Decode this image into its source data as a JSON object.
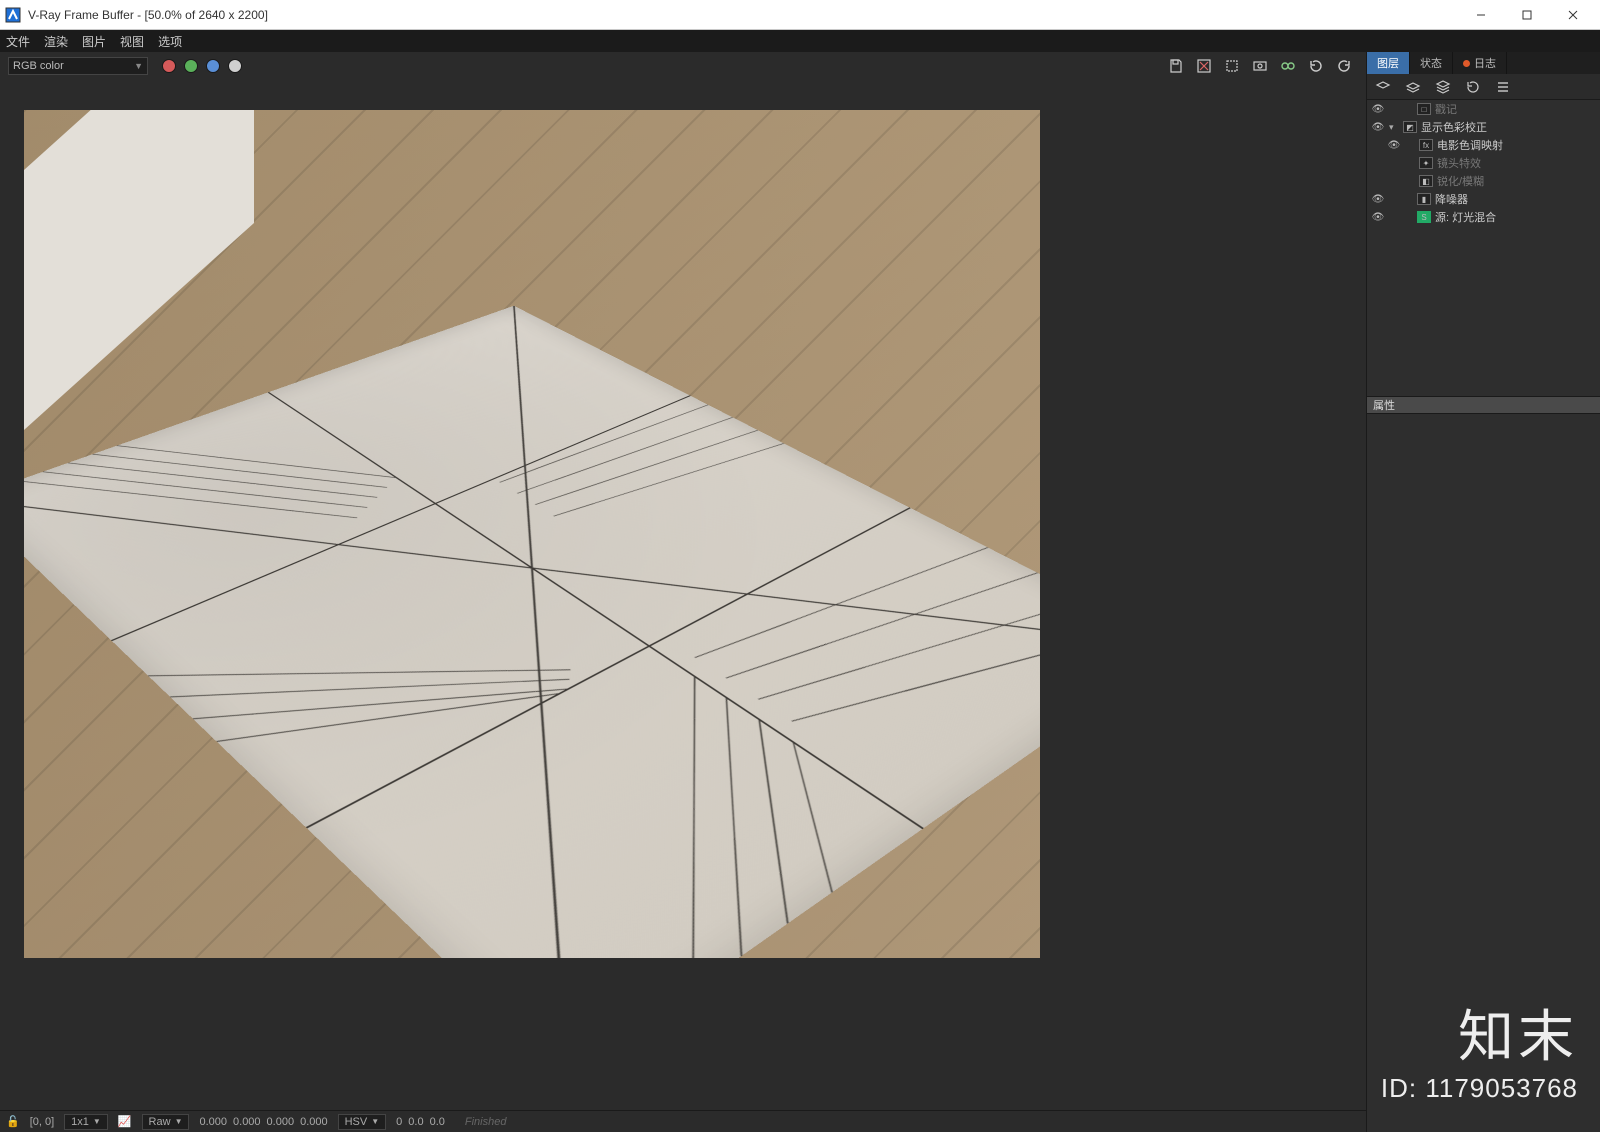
{
  "window": {
    "title": "V-Ray Frame Buffer - [50.0% of 2640 x 2200]"
  },
  "menu": {
    "items": [
      "文件",
      "渲染",
      "图片",
      "视图",
      "选项"
    ]
  },
  "toolbar": {
    "channel_dropdown": "RGB color"
  },
  "viewport": {
    "status_label": "Finished"
  },
  "statusbar": {
    "lock_icon": "🔓",
    "coords": "[0, 0]",
    "zoom": "1x1",
    "raw_label": "Raw",
    "raw_values": [
      "0.000",
      "0.000",
      "0.000",
      "0.000"
    ],
    "hsv_label": "HSV",
    "hsv_values": [
      "0",
      "0.0",
      "0.0"
    ]
  },
  "right_panel": {
    "tabs": {
      "layers": "图层",
      "status": "状态",
      "log": "日志"
    },
    "layers": [
      {
        "name": "戳记",
        "visible": true,
        "expandable": false,
        "dim": true
      },
      {
        "name": "显示色彩校正",
        "visible": true,
        "expandable": true,
        "dim": false
      },
      {
        "name": "电影色调映射",
        "visible": true,
        "expandable": false,
        "dim": false,
        "indent": 1
      },
      {
        "name": "镜头特效",
        "visible": false,
        "expandable": false,
        "dim": true,
        "indent": 1
      },
      {
        "name": "锐化/模糊",
        "visible": false,
        "expandable": false,
        "dim": true,
        "indent": 1
      },
      {
        "name": "降噪器",
        "visible": true,
        "expandable": false,
        "dim": false
      },
      {
        "name": "源: 灯光混合",
        "visible": true,
        "expandable": false,
        "dim": false
      }
    ],
    "properties_header": "属性"
  },
  "watermark": {
    "brand": "知末",
    "id_label": "ID: 1179053768"
  }
}
